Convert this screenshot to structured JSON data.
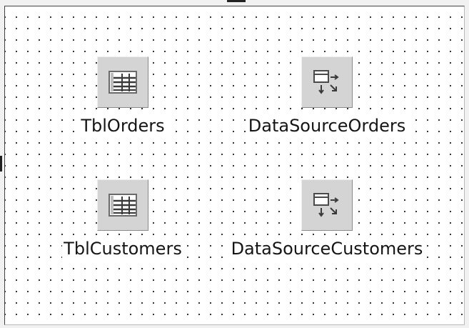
{
  "components": [
    {
      "label": "TblOrders",
      "icon": "table-icon"
    },
    {
      "label": "DataSourceOrders",
      "icon": "datasource-icon"
    },
    {
      "label": "TblCustomers",
      "icon": "table-icon"
    },
    {
      "label": "DataSourceCustomers",
      "icon": "datasource-icon"
    }
  ]
}
